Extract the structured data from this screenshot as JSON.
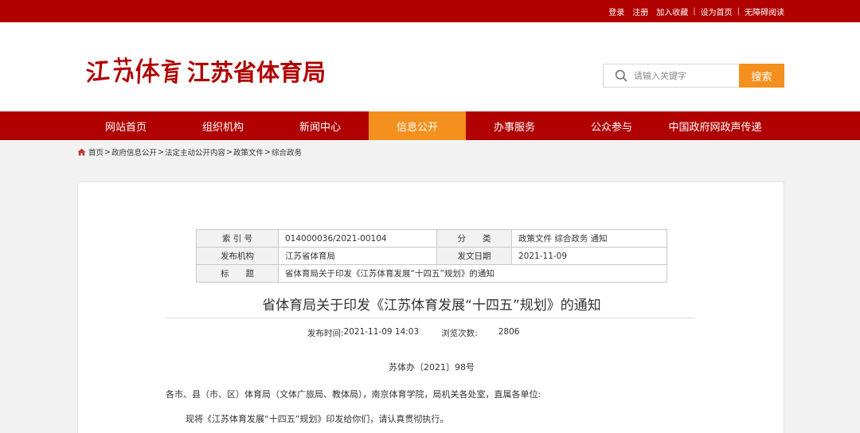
{
  "topbar": {
    "links": [
      "登录",
      "注册",
      "加入收藏",
      "设为首页",
      "无障碍阅读"
    ]
  },
  "header": {
    "logo_calligraphy": "江苏体育",
    "logo_text": "江苏省体育局",
    "search_placeholder": "请输入关键字",
    "search_button": "搜索"
  },
  "nav": {
    "items": [
      "网站首页",
      "组织机构",
      "新闻中心",
      "信息公开",
      "办事服务",
      "公众参与",
      "中国政府网政声传递"
    ],
    "active": "信息公开"
  },
  "breadcrumb": {
    "items": [
      "首页",
      "政府信息公开",
      "法定主动公开内容",
      "政策文件",
      "综合政务"
    ],
    "separator": ">"
  },
  "meta": {
    "index_label": "索 引 号",
    "index_value": "014000036/2021-00104",
    "category_label": "分　　类",
    "category_value": "政策文件 综合政务 通知",
    "publisher_label": "发布机构",
    "publisher_value": "江苏省体育局",
    "date_label": "发文日期",
    "date_value": "2021-11-09",
    "title_label": "标　　题",
    "title_value": "省体育局关于印发《江苏体育发展“十四五”规划》的通知"
  },
  "article": {
    "title": "省体育局关于印发《江苏体育发展“十四五”规划》的通知",
    "published_label": "发布时间:",
    "published_value": "2021-11-09 14:03",
    "views_label": "浏览次数:",
    "views_value": "2806",
    "doc_number": "苏体办〔2021〕98号",
    "para1": "各市、县（市、区）体育局（文体广旅局、教体局），南京体育学院，局机关各处室，直属各单位:",
    "para2": "现将《江苏体育发展“十四五”规划》印发给你们，请认真贯彻执行。"
  },
  "colors": {
    "brand_red": "#b00000",
    "accent_orange": "#f4901e"
  }
}
